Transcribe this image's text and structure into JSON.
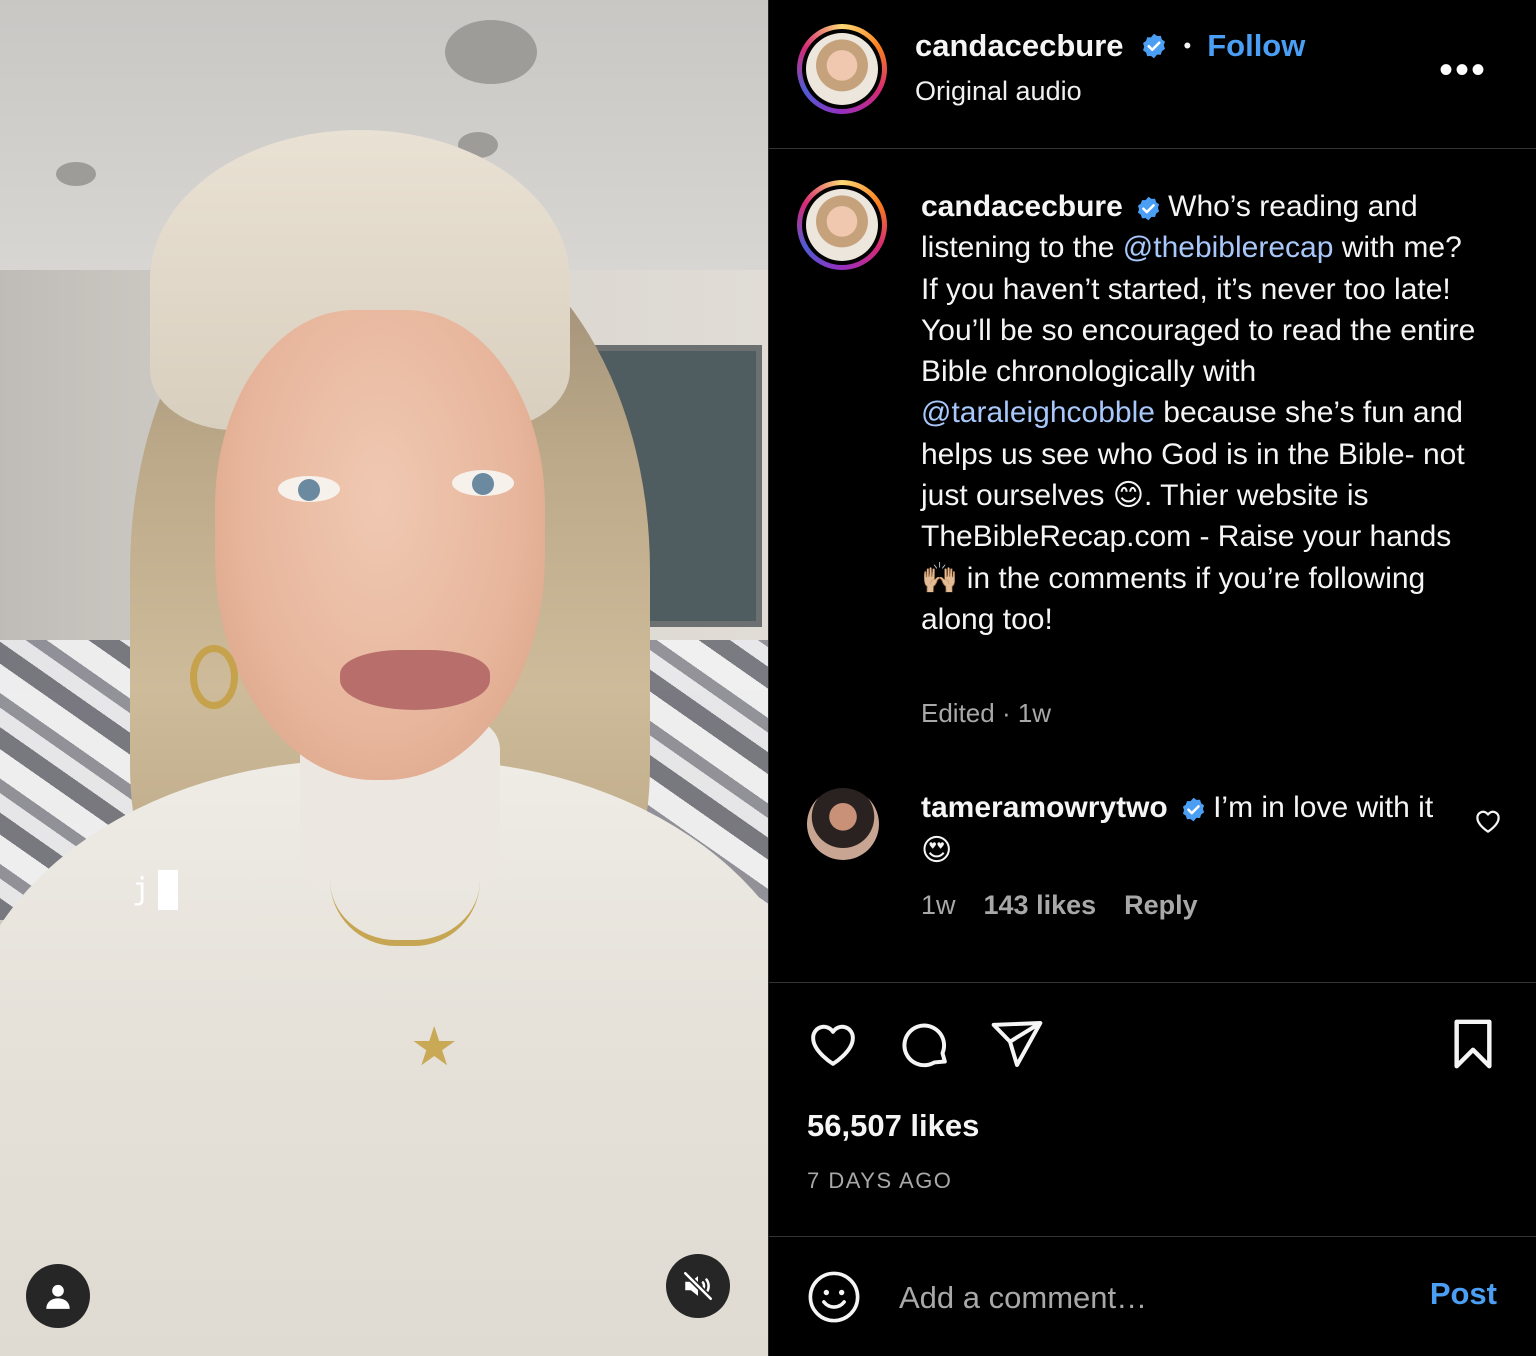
{
  "post": {
    "username": "candacecbure",
    "follow_label": "Follow",
    "separator": "•",
    "audio": "Original audio",
    "more_label": "•••"
  },
  "video_overlay": {
    "typed_text": "j"
  },
  "caption": {
    "username": "candacecbure",
    "text_1": "Who’s reading and listening to the ",
    "mention_1": "@thebiblerecap",
    "text_2": " with me? If you haven’t started, it’s never too late! You’ll be so encouraged to read the entire Bible chronologically with ",
    "mention_2": "@taraleighcobble",
    "text_3": " because she’s fun and helps us see who God is in the Bible- not just ourselves 😊. Thier website is TheBibleRecap.com - Raise your hands 🙌🏼 in the comments if you’re following along too!",
    "meta": "Edited · 1w"
  },
  "comment": {
    "username": "tameramowrytwo",
    "text": "I’m in love with it 😍",
    "time": "1w",
    "likes": "143 likes",
    "reply_label": "Reply"
  },
  "stats": {
    "likes": "56,507 likes",
    "date": "7 DAYS AGO"
  },
  "add_comment": {
    "placeholder": "Add a comment…",
    "post_label": "Post"
  },
  "colors": {
    "accent": "#4a9ff5",
    "mention": "#a8c7fa",
    "muted": "#a8a8a8",
    "background": "#000000"
  },
  "icons": [
    "verified-badge-icon",
    "more-options-icon",
    "heart-icon",
    "comment-icon",
    "share-icon",
    "bookmark-icon",
    "emoji-icon",
    "user-icon",
    "muted-speaker-icon"
  ]
}
